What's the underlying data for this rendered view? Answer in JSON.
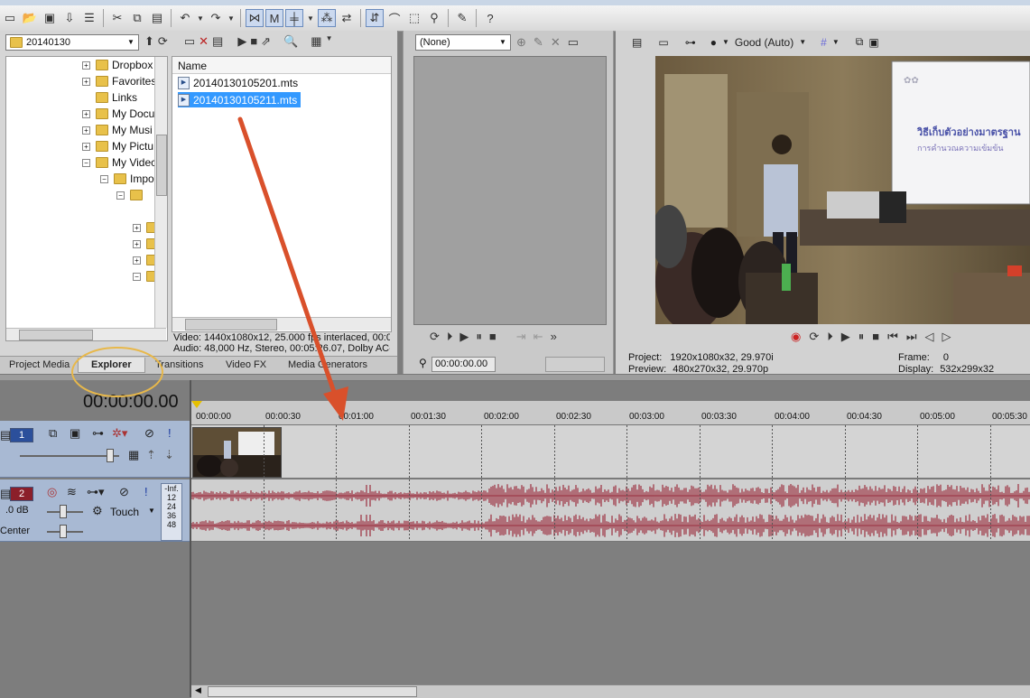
{
  "toolbar": {
    "icons": [
      "new-icon",
      "open-icon",
      "save-icon",
      "render-icon",
      "properties-icon",
      "cut-icon",
      "copy-icon",
      "paste-icon",
      "undo-icon",
      "redo-icon",
      "snap-icon",
      "auto-ripple-icon",
      "lock-envelope-icon",
      "crossfade-icon",
      "normal-edit-icon",
      "envelope-edit-icon",
      "selection-edit-icon",
      "zoom-edit-icon",
      "enable-snapping-icon",
      "whats-this-icon"
    ]
  },
  "explorer": {
    "folder_combo": "20140130",
    "tree": [
      {
        "label": "Dropbox",
        "depth": 0,
        "expander": "+"
      },
      {
        "label": "Favorites",
        "depth": 0,
        "expander": "+"
      },
      {
        "label": "Links",
        "depth": 0,
        "expander": ""
      },
      {
        "label": "My Docu",
        "depth": 0,
        "expander": "+"
      },
      {
        "label": "My Musi",
        "depth": 0,
        "expander": "+"
      },
      {
        "label": "My Pictu",
        "depth": 0,
        "expander": "+"
      },
      {
        "label": "My Videc",
        "depth": 0,
        "expander": "−"
      },
      {
        "label": "Impo",
        "depth": 1,
        "expander": "−"
      },
      {
        "label": "",
        "depth": 2,
        "expander": "−"
      },
      {
        "label": "",
        "depth": 3,
        "expander": "+"
      },
      {
        "label": "",
        "depth": 3,
        "expander": "+"
      },
      {
        "label": "",
        "depth": 3,
        "expander": "+"
      },
      {
        "label": "",
        "depth": 3,
        "expander": "−"
      }
    ],
    "list_header": "Name",
    "files": [
      "20140130105201.mts",
      "20140130105211.mts"
    ],
    "media_info_video": "Video: 1440x1080x12, 25.000 fps interlaced, 00:00",
    "media_info_audio": "Audio: 48,000 Hz, Stereo, 00:05:26.07, Dolby AC-3",
    "tabs": [
      "Project Media",
      "Explorer",
      "Transitions",
      "Video FX",
      "Media Generators"
    ]
  },
  "trimmer": {
    "combo": "(None)",
    "timecode": "00:00:00.00"
  },
  "preview": {
    "quality": "Good (Auto)",
    "project_label": "Project:",
    "project_value": "1920x1080x32, 29.970i",
    "preview_label": "Preview:",
    "preview_value": "480x270x32, 29.970p",
    "frame_label": "Frame:",
    "frame_value": "0",
    "display_label": "Display:",
    "display_value": "532x299x32",
    "slide_line1": "วิธีเก็บตัวอย่างมาตรฐาน",
    "slide_line2": "การคำนวณความเข้มข้น"
  },
  "timeline": {
    "cursor_time": "00:00:00.00",
    "ruler": [
      "00:00:00",
      "00:00:30",
      "00:01:00",
      "00:01:30",
      "00:02:00",
      "00:02:30",
      "00:03:00",
      "00:03:30",
      "00:04:00",
      "00:04:30",
      "00:05:00",
      "00:05:30"
    ],
    "video_track_number": "1",
    "audio_track_number": "2",
    "audio_volume": ".0 dB",
    "audio_pan": "Center",
    "automation_mode": "Touch",
    "meter_labels": [
      "-Inf.",
      "12",
      "24",
      "36",
      "48"
    ]
  },
  "colors": {
    "annotation_arrow": "#d9502b",
    "highlight_ellipse": "#e8b84a",
    "waveform": "#9b2f3f",
    "selection": "#3399ff"
  }
}
